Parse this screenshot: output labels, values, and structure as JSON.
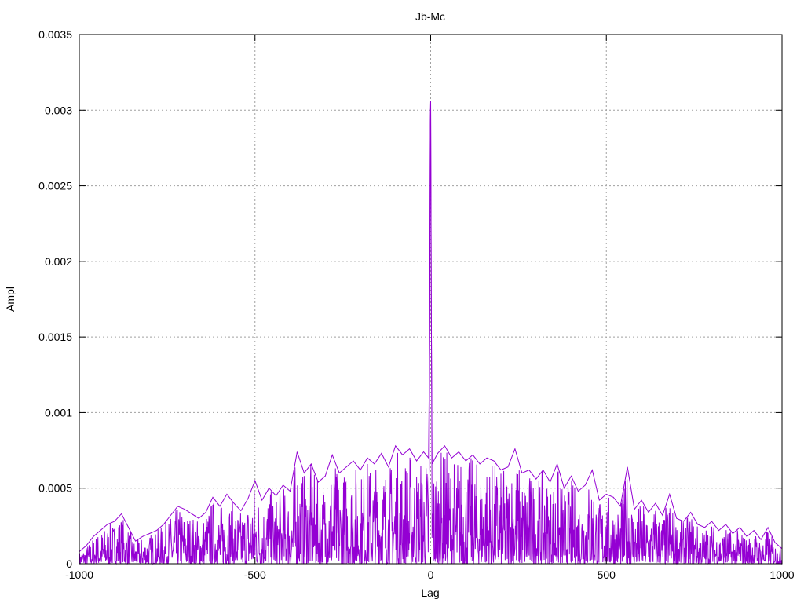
{
  "chart_data": {
    "type": "line",
    "title": "Jb-Mc",
    "xlabel": "Lag",
    "ylabel": "Ampl",
    "xlim": [
      -1000,
      1000
    ],
    "ylim": [
      0,
      0.0035
    ],
    "x_ticks": [
      -1000,
      -500,
      0,
      500,
      1000
    ],
    "x_tick_labels": [
      "-1000",
      "-500",
      "0",
      "500",
      "1000"
    ],
    "y_ticks": [
      0,
      0.0005,
      0.001,
      0.0015,
      0.002,
      0.0025,
      0.003,
      0.0035
    ],
    "y_tick_labels": [
      "0",
      "0.0005",
      "0.001",
      "0.0015",
      "0.002",
      "0.0025",
      "0.003",
      "0.0035"
    ],
    "grid": true,
    "series": [
      {
        "color": "#9400d3",
        "points": [
          [
            -1000,
            8e-05
          ],
          [
            -980,
            0.00012
          ],
          [
            -960,
            0.00018
          ],
          [
            -940,
            0.00022
          ],
          [
            -920,
            0.00026
          ],
          [
            -900,
            0.00028
          ],
          [
            -880,
            0.00033
          ],
          [
            -860,
            0.00024
          ],
          [
            -840,
            0.00015
          ],
          [
            -820,
            0.00018
          ],
          [
            -800,
            0.0002
          ],
          [
            -780,
            0.00022
          ],
          [
            -760,
            0.00026
          ],
          [
            -740,
            0.00032
          ],
          [
            -720,
            0.00038
          ],
          [
            -700,
            0.00036
          ],
          [
            -680,
            0.00033
          ],
          [
            -660,
            0.0003
          ],
          [
            -640,
            0.00034
          ],
          [
            -620,
            0.00044
          ],
          [
            -600,
            0.00038
          ],
          [
            -580,
            0.00046
          ],
          [
            -560,
            0.0004
          ],
          [
            -540,
            0.00035
          ],
          [
            -520,
            0.00043
          ],
          [
            -500,
            0.00055
          ],
          [
            -480,
            0.00042
          ],
          [
            -460,
            0.0005
          ],
          [
            -440,
            0.00045
          ],
          [
            -420,
            0.00052
          ],
          [
            -400,
            0.00048
          ],
          [
            -380,
            0.00074
          ],
          [
            -360,
            0.0006
          ],
          [
            -340,
            0.00066
          ],
          [
            -320,
            0.00054
          ],
          [
            -300,
            0.00058
          ],
          [
            -280,
            0.00072
          ],
          [
            -260,
            0.0006
          ],
          [
            -240,
            0.00064
          ],
          [
            -220,
            0.00068
          ],
          [
            -200,
            0.00062
          ],
          [
            -180,
            0.0007
          ],
          [
            -160,
            0.00066
          ],
          [
            -140,
            0.00073
          ],
          [
            -120,
            0.00064
          ],
          [
            -100,
            0.00078
          ],
          [
            -80,
            0.00072
          ],
          [
            -60,
            0.00076
          ],
          [
            -40,
            0.00068
          ],
          [
            -20,
            0.00074
          ],
          [
            -6,
            0.0007
          ],
          [
            -3,
            0.00145
          ],
          [
            -1,
            0.0029
          ],
          [
            0,
            0.00306
          ],
          [
            2,
            0.00162
          ],
          [
            4,
            0.00066
          ],
          [
            20,
            0.00073
          ],
          [
            40,
            0.00078
          ],
          [
            60,
            0.0007
          ],
          [
            80,
            0.00074
          ],
          [
            100,
            0.00068
          ],
          [
            120,
            0.00072
          ],
          [
            140,
            0.00066
          ],
          [
            160,
            0.0007
          ],
          [
            180,
            0.00068
          ],
          [
            200,
            0.00062
          ],
          [
            220,
            0.00064
          ],
          [
            240,
            0.00076
          ],
          [
            260,
            0.0006
          ],
          [
            280,
            0.00062
          ],
          [
            300,
            0.00056
          ],
          [
            320,
            0.00062
          ],
          [
            340,
            0.00054
          ],
          [
            360,
            0.00066
          ],
          [
            380,
            0.0005
          ],
          [
            400,
            0.00058
          ],
          [
            420,
            0.00048
          ],
          [
            440,
            0.00052
          ],
          [
            460,
            0.00062
          ],
          [
            480,
            0.00042
          ],
          [
            500,
            0.00046
          ],
          [
            520,
            0.00044
          ],
          [
            540,
            0.00038
          ],
          [
            560,
            0.00064
          ],
          [
            580,
            0.00036
          ],
          [
            600,
            0.00042
          ],
          [
            620,
            0.00034
          ],
          [
            640,
            0.0004
          ],
          [
            660,
            0.00032
          ],
          [
            680,
            0.00046
          ],
          [
            700,
            0.0003
          ],
          [
            720,
            0.00028
          ],
          [
            740,
            0.00034
          ],
          [
            760,
            0.00026
          ],
          [
            780,
            0.00024
          ],
          [
            800,
            0.00028
          ],
          [
            820,
            0.00022
          ],
          [
            840,
            0.00026
          ],
          [
            860,
            0.0002
          ],
          [
            880,
            0.00024
          ],
          [
            900,
            0.00018
          ],
          [
            920,
            0.00022
          ],
          [
            940,
            0.00016
          ],
          [
            960,
            0.00024
          ],
          [
            980,
            0.00014
          ],
          [
            1000,
            0.0001
          ]
        ]
      }
    ]
  }
}
